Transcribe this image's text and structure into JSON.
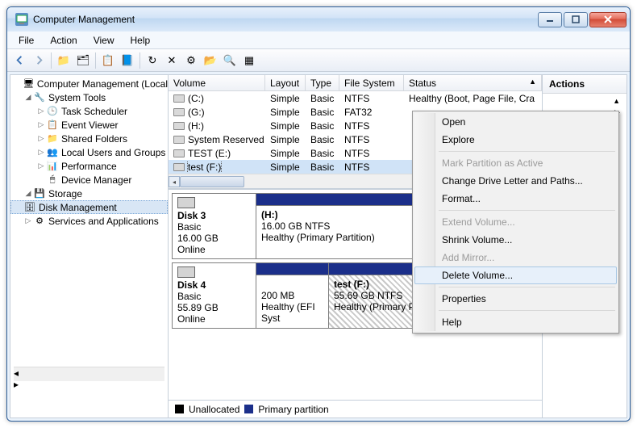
{
  "window": {
    "title": "Computer Management"
  },
  "menubar": [
    "File",
    "Action",
    "View",
    "Help"
  ],
  "tree": {
    "root": "Computer Management (Local",
    "systools": "System Tools",
    "items_systools": [
      "Task Scheduler",
      "Event Viewer",
      "Shared Folders",
      "Local Users and Groups",
      "Performance",
      "Device Manager"
    ],
    "storage": "Storage",
    "diskmgmt": "Disk Management",
    "services": "Services and Applications"
  },
  "columns": {
    "volume": "Volume",
    "layout": "Layout",
    "type": "Type",
    "fs": "File System",
    "status": "Status"
  },
  "volumes": [
    {
      "name": "(C:)",
      "layout": "Simple",
      "type": "Basic",
      "fs": "NTFS",
      "status": "Healthy (Boot, Page File, Cra"
    },
    {
      "name": "(G:)",
      "layout": "Simple",
      "type": "Basic",
      "fs": "FAT32",
      "status": ""
    },
    {
      "name": "(H:)",
      "layout": "Simple",
      "type": "Basic",
      "fs": "NTFS",
      "status": ""
    },
    {
      "name": "System Reserved",
      "layout": "Simple",
      "type": "Basic",
      "fs": "NTFS",
      "status": ""
    },
    {
      "name": "TEST (E:)",
      "layout": "Simple",
      "type": "Basic",
      "fs": "NTFS",
      "status": ""
    },
    {
      "name": "test (F:)",
      "layout": "Simple",
      "type": "Basic",
      "fs": "NTFS",
      "status": "",
      "selected": true
    }
  ],
  "disks": {
    "d3": {
      "label": "Disk 3",
      "type": "Basic",
      "size": "16.00 GB",
      "state": "Online",
      "part": {
        "name": "(H:)",
        "size": "16.00 GB NTFS",
        "status": "Healthy (Primary Partition)"
      }
    },
    "d4": {
      "label": "Disk 4",
      "type": "Basic",
      "size": "55.89 GB",
      "state": "Online",
      "p1": {
        "size": "200 MB",
        "status": "Healthy (EFI Syst"
      },
      "p2": {
        "name": "test  (F:)",
        "size": "55.69 GB NTFS",
        "status": "Healthy (Primary Partition)"
      }
    }
  },
  "legend": {
    "unalloc": "Unallocated",
    "primary": "Primary partition"
  },
  "actions": {
    "header": "Actions"
  },
  "context": {
    "open": "Open",
    "explore": "Explore",
    "mark": "Mark Partition as Active",
    "change": "Change Drive Letter and Paths...",
    "format": "Format...",
    "extend": "Extend Volume...",
    "shrink": "Shrink Volume...",
    "mirror": "Add Mirror...",
    "delete": "Delete Volume...",
    "props": "Properties",
    "help": "Help"
  }
}
